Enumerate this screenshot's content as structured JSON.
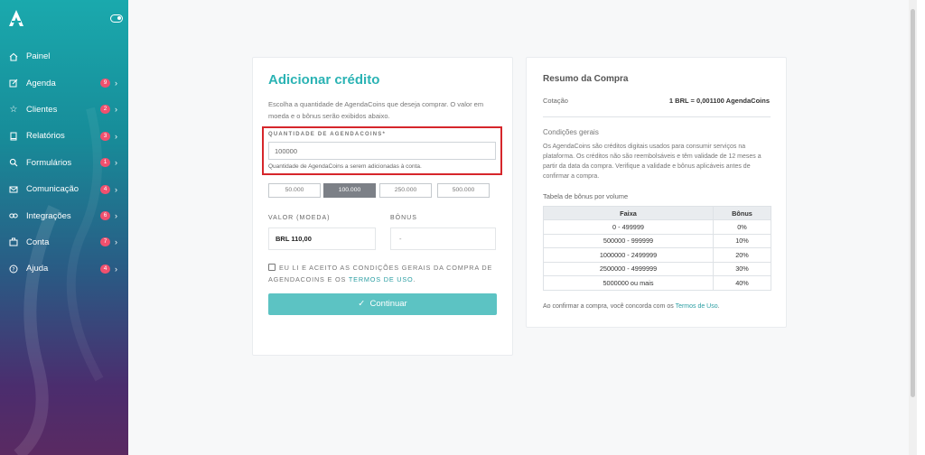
{
  "sidebar": {
    "logo_icon": "agenda-logo-icon",
    "toggle_icon": "sidebar-toggle-icon",
    "items": [
      {
        "label": "Painel",
        "icon": "home-icon",
        "badge": "",
        "chevron": false
      },
      {
        "label": "Agenda",
        "icon": "edit-icon",
        "badge": "9",
        "chevron": true
      },
      {
        "label": "Clientes",
        "icon": "star-icon",
        "badge": "2",
        "chevron": true
      },
      {
        "label": "Relatórios",
        "icon": "book-icon",
        "badge": "3",
        "chevron": true
      },
      {
        "label": "Formulários",
        "icon": "search-icon",
        "badge": "1",
        "chevron": true
      },
      {
        "label": "Comunicação",
        "icon": "mail-icon",
        "badge": "4",
        "chevron": true
      },
      {
        "label": "Integrações",
        "icon": "link-icon",
        "badge": "6",
        "chevron": true
      },
      {
        "label": "Conta",
        "icon": "building-icon",
        "badge": "7",
        "chevron": true
      },
      {
        "label": "Ajuda",
        "icon": "help-icon",
        "badge": "4",
        "chevron": true
      }
    ]
  },
  "form": {
    "title": "Adicionar crédito",
    "intro": "Escolha a quantidade de AgendaCoins que deseja comprar. O valor em moeda e o bônus serão exibidos abaixo.",
    "qty_label": "QUANTIDADE DE AGENDACOINS*",
    "qty_value": "100000",
    "qty_help": "Quantidade de AgendaCoins a serem adicionadas à conta.",
    "presets": [
      "50.000",
      "100.000",
      "250.000",
      "500.000"
    ],
    "active_preset": "100.000",
    "value_label": "VALOR (MOEDA)",
    "value": "BRL 110,00",
    "bonus_label": "BÔNUS",
    "bonus_value": "-",
    "terms_text": "EU LI E ACEITO AS CONDIÇÕES GERAIS DA COMPRA DE AGENDACOINS E OS",
    "terms_link": "TERMOS DE USO",
    "terms_end": ".",
    "continue_label": "Continuar"
  },
  "summary": {
    "title": "Resumo da Compra",
    "cotacao_label": "Cotação",
    "cotacao_value": "1 BRL = 0,001100 AgendaCoins",
    "conditions_title": "Condições gerais",
    "conditions_text": "Os AgendaCoins são créditos digitais usados para consumir serviços na plataforma. Os créditos não são reembolsáveis e têm validade de 12 meses a partir da data da compra. Verifique a validade e bônus aplicáveis antes de confirmar a compra.",
    "table_title": "Tabela de bônus por volume",
    "table_headers": [
      "Faixa",
      "Bônus"
    ],
    "table_rows": [
      [
        "0 - 499999",
        "0%"
      ],
      [
        "500000 - 999999",
        "10%"
      ],
      [
        "1000000 - 2499999",
        "20%"
      ],
      [
        "2500000 - 4999999",
        "30%"
      ],
      [
        "5000000 ou mais",
        "40%"
      ]
    ],
    "footer_text": "Ao confirmar a compra, você concorda com os",
    "footer_link": "Termos de Uso",
    "footer_end": "."
  },
  "colors": {
    "accent": "#2bb3b4",
    "button": "#5cc3c3",
    "highlight_border": "#d6262b",
    "badge": "#f0506e"
  }
}
